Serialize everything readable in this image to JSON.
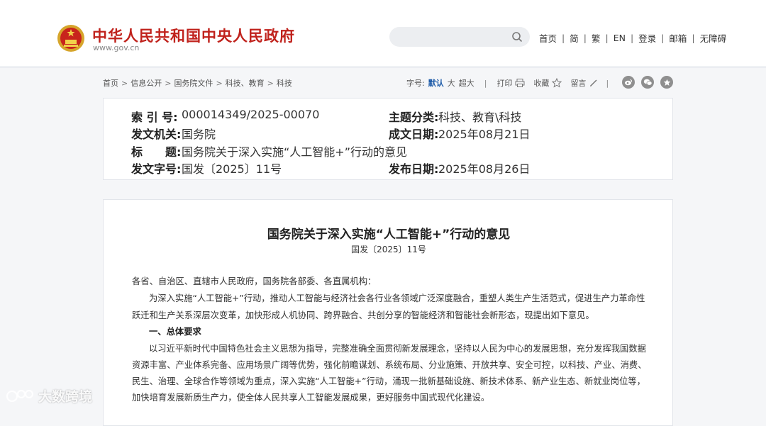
{
  "site": {
    "title": "中华人民共和国中央人民政府",
    "url": "www.gov.cn"
  },
  "search": {
    "placeholder": ""
  },
  "topnav": [
    "首页",
    "简",
    "繁",
    "EN",
    "登录",
    "邮箱",
    "无障碍"
  ],
  "breadcrumb": [
    "首页",
    "信息公开",
    "国务院文件",
    "科技、教育",
    "科技"
  ],
  "tools": {
    "font_label": "字号:",
    "font_default": "默认",
    "font_large": "大",
    "font_xlarge": "超大",
    "print": "打印",
    "favorite": "收藏",
    "comment": "留言"
  },
  "meta": {
    "index_label": "索 引 号:",
    "index_value": "000014349/2025-00070",
    "topic_label": "主题分类:",
    "topic_value": "科技、教育\\科技",
    "issuer_label": "发文机关:",
    "issuer_value": "国务院",
    "written_label": "成文日期:",
    "written_value": "2025年08月21日",
    "title_label": "标　　题:",
    "title_value": "国务院关于深入实施“人工智能+”行动的意见",
    "docno_label": "发文字号:",
    "docno_value": "国发〔2025〕11号",
    "published_label": "发布日期:",
    "published_value": "2025年08月26日"
  },
  "document": {
    "title": "国务院关于深入实施“人工智能+”行动的意见",
    "number": "国发〔2025〕11号",
    "salutation": "各省、自治区、直辖市人民政府，国务院各部委、各直属机构：",
    "intro_line1": "为深入实施“人工智能+”行动，推动人工智能与经济社会各行业各领域广泛深度融合，重塑人类生产生活范式，促进生产力革命性",
    "intro_line2": "跃迁和生产关系深层次变革，加快形成人机协同、跨界融合、共创分享的智能经济和智能社会新形态，现提出如下意见。",
    "section1_heading": "一、总体要求",
    "section1_line1": "以习近平新时代中国特色社会主义思想为指导，完整准确全面贯彻新发展理念，坚持以人民为中心的发展思想，充分发挥我国数据",
    "section1_line2": "资源丰富、产业体系完备、应用场景广阔等优势，强化前瞻谋划、系统布局、分业施策、开放共享、安全可控，以科技、产业、消费、",
    "section1_line3": "民生、治理、全球合作等领域为重点，深入实施“人工智能+”行动，涌现一批新基础设施、新技术体系、新产业生态、新就业岗位等，",
    "section1_line4": "加快培育发展新质生产力，使全体人民共享人工智能发展成果，更好服务中国式现代化建设。"
  },
  "watermark": {
    "text": "大数跨境"
  },
  "colors": {
    "brand_red": "#c0221c",
    "link_blue": "#1c5aa8",
    "page_bg": "#f5f6f8"
  }
}
